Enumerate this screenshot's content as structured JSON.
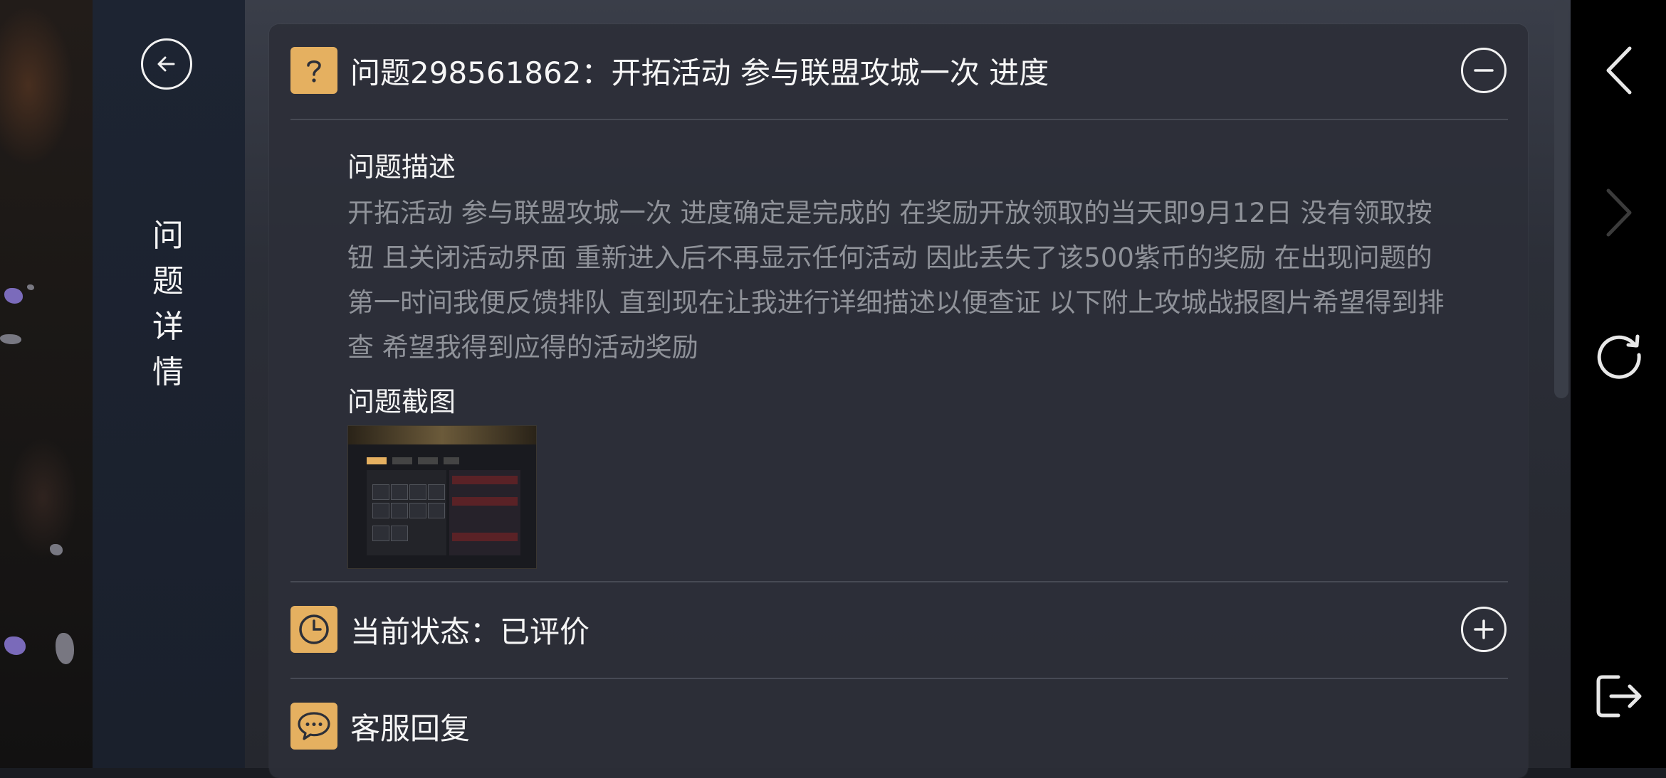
{
  "nav": {
    "back_icon": "back-arrow-circle-icon",
    "title": "问题详情"
  },
  "issue": {
    "title": "问题298561862：开拓活动 参与联盟攻城一次 进度",
    "icon": "question-icon",
    "toggle_icon": "minus-circle-icon",
    "description_label": "问题描述",
    "description": "开拓活动 参与联盟攻城一次 进度确定是完成的 在奖励开放领取的当天即9月12日 没有领取按钮 且关闭活动界面 重新进入后不再显示任何活动 因此丢失了该500紫币的奖励 在出现问题的第一时间我便反馈排队 直到现在让我进行详细描述以便查证 以下附上攻城战报图片希望得到排查 希望我得到应得的活动奖励",
    "screenshot_label": "问题截图"
  },
  "status": {
    "title": "当前状态：已评价",
    "icon": "clock-icon",
    "toggle_icon": "plus-circle-icon"
  },
  "reply": {
    "title": "客服回复",
    "icon": "chat-bubble-icon"
  },
  "system_bar": {
    "back": "chevron-left-icon",
    "forward": "chevron-right-icon",
    "refresh": "refresh-icon",
    "exit": "exit-icon"
  },
  "colors": {
    "accent": "#e5b060",
    "panel": "#2c2f38",
    "nav": "#1d2432"
  }
}
